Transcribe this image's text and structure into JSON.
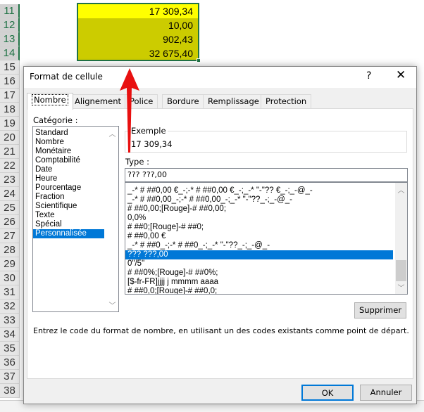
{
  "sheet": {
    "rows": [
      "11",
      "12",
      "13",
      "14",
      "15",
      "16",
      "17",
      "18",
      "19",
      "20",
      "21",
      "22",
      "23",
      "24",
      "25",
      "26",
      "27",
      "28",
      "29",
      "30",
      "31",
      "32",
      "33",
      "34",
      "35",
      "36",
      "37",
      "38"
    ],
    "cells": [
      "17 309,34",
      "10,00",
      "902,43",
      "32 675,40"
    ],
    "colors": {
      "highlight": "#ffff00",
      "fill": "#cccc00",
      "selection": "#217346"
    }
  },
  "dialog": {
    "title": "Format de cellule",
    "help": "?",
    "close": "✕",
    "tabs": [
      "Nombre",
      "Alignement",
      "Police",
      "Bordure",
      "Remplissage",
      "Protection"
    ],
    "active_tab": "Nombre",
    "category_label": "Catégorie :",
    "categories": [
      "Standard",
      "Nombre",
      "Monétaire",
      "Comptabilité",
      "Date",
      "Heure",
      "Pourcentage",
      "Fraction",
      "Scientifique",
      "Texte",
      "Spécial",
      "Personnalisée"
    ],
    "selected_category": "Personnalisée",
    "example_label": "Exemple",
    "example_value": "17 309,34",
    "type_label": "Type :",
    "type_value": "??? ???,00",
    "formats": [
      "_-* # ##0,00 €_-;-* # ##0,00 €_-;_-* \"-\"?? €_-;_-@_-",
      "_-* # ##0,00_-;-* # ##0,00_-;_-* \"-\"??_-;_-@_-",
      "# ##0,00;[Rouge]-# ##0,00;",
      "0,0%",
      "# ##0;[Rouge]-# ##0;",
      "# ##0,00 €",
      "_-* # ##0_-;-* # ##0_-;_-* \"-\"??_-;_-@_-",
      "??? ???,00",
      "0\"/5\"",
      "# ##0%;[Rouge]-# ##0%;",
      "[$-fr-FR]jjjj j mmmm aaaa",
      "# ##0,0;[Rouge]-# ##0,0;"
    ],
    "selected_format": "??? ???,00",
    "delete_label": "Supprimer",
    "description": "Entrez le code du format de nombre, en utilisant un des codes existants comme point de départ.",
    "ok_label": "OK",
    "cancel_label": "Annuler"
  },
  "annotation": {
    "arrow_color": "#e81010",
    "icon": "red-arrow-up"
  }
}
